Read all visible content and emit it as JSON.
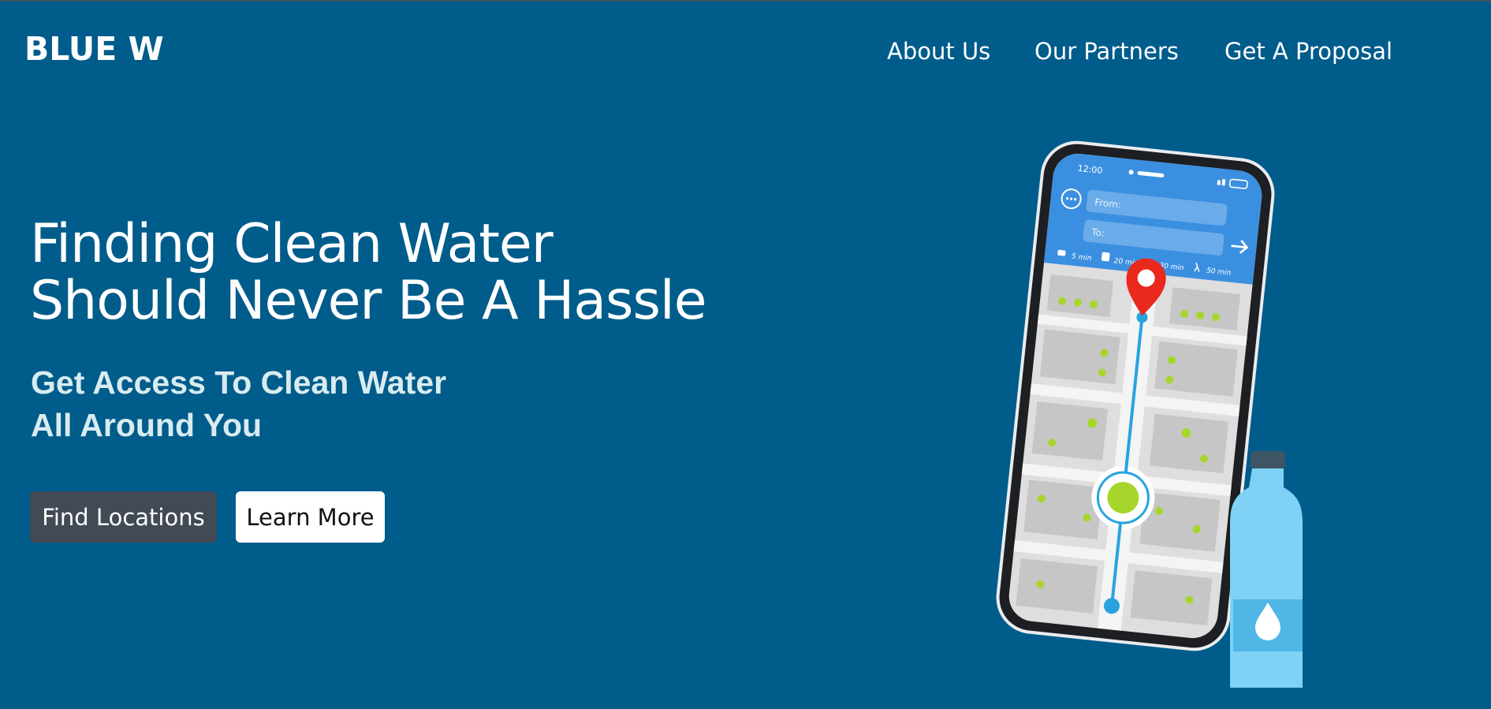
{
  "brand": {
    "logo_text": "BLUE W"
  },
  "nav": {
    "items": [
      {
        "label": "About Us"
      },
      {
        "label": "Our Partners"
      },
      {
        "label": "Get A Proposal"
      }
    ]
  },
  "hero": {
    "title_line1": "Finding Clean Water",
    "title_line2": "Should Never Be A Hassle",
    "subtitle_line1": "Get Access To Clean Water",
    "subtitle_line2": "All Around You",
    "primary_button": "Find Locations",
    "secondary_button": "Learn More"
  },
  "illustration": {
    "phone_time": "12:00",
    "from_placeholder": "From:",
    "to_placeholder": "To:",
    "modes": [
      "5 min",
      "20 min",
      "30 min",
      "50 min"
    ],
    "icons": [
      "map-pin-icon",
      "arrow-right-icon",
      "menu-dots-icon",
      "car-icon",
      "bus-icon",
      "bike-icon",
      "walk-icon",
      "water-drop-icon"
    ]
  },
  "colors": {
    "background": "#005c8b",
    "primary_button": "#414a55",
    "subtitle": "#d8ecf0",
    "phone_header": "#3b8fe0",
    "pin": "#e8291c",
    "route": "#29a3df",
    "tree": "#a6d62c",
    "bottle": "#7fd2f6"
  }
}
